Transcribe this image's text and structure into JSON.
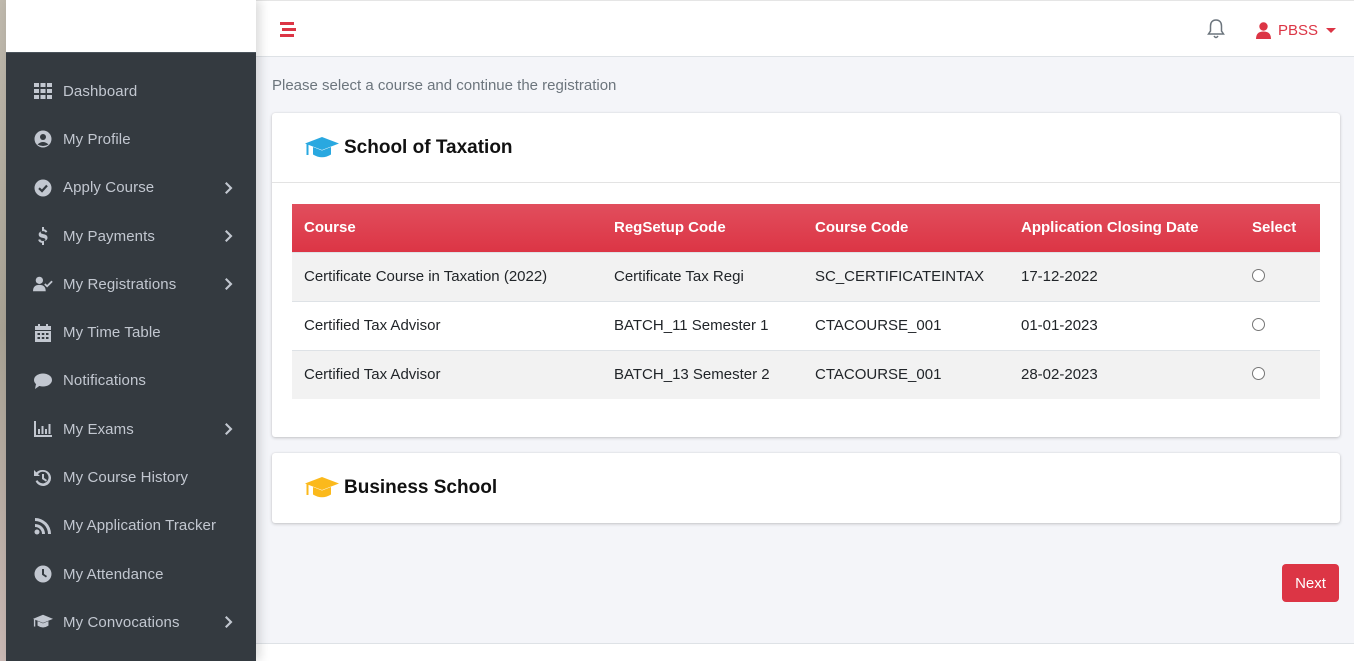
{
  "sidebar": {
    "items": [
      {
        "label": "Dashboard",
        "icon": "grid-icon",
        "has_submenu": false
      },
      {
        "label": "My Profile",
        "icon": "user-circle-icon",
        "has_submenu": false
      },
      {
        "label": "Apply Course",
        "icon": "check-circle-icon",
        "has_submenu": true
      },
      {
        "label": "My Payments",
        "icon": "dollar-icon",
        "has_submenu": true
      },
      {
        "label": "My Registrations",
        "icon": "user-check-icon",
        "has_submenu": true
      },
      {
        "label": "My Time Table",
        "icon": "calendar-icon",
        "has_submenu": false
      },
      {
        "label": "Notifications",
        "icon": "comment-icon",
        "has_submenu": false
      },
      {
        "label": "My Exams",
        "icon": "chart-bar-icon",
        "has_submenu": true
      },
      {
        "label": "My Course History",
        "icon": "history-icon",
        "has_submenu": false
      },
      {
        "label": "My Application Tracker",
        "icon": "rss-icon",
        "has_submenu": false
      },
      {
        "label": "My Attendance",
        "icon": "clock-icon",
        "has_submenu": false
      },
      {
        "label": "My Convocations",
        "icon": "graduation-cap-icon",
        "has_submenu": true
      }
    ]
  },
  "topbar": {
    "user_name": "PBSS"
  },
  "main": {
    "intro": "Please select a course and continue the registration",
    "schools": [
      {
        "title": "School of Taxation",
        "icon_color": "#29a8e0",
        "table": {
          "headers": [
            "Course",
            "RegSetup Code",
            "Course Code",
            "Application Closing Date",
            "Select"
          ],
          "rows": [
            {
              "course": "Certificate Course in Taxation (2022)",
              "regsetup": "Certificate Tax Regi",
              "code": "SC_CERTIFICATEINTAX",
              "closing": "17-12-2022",
              "selected": false
            },
            {
              "course": "Certified Tax Advisor",
              "regsetup": "BATCH_11 Semester 1",
              "code": "CTACOURSE_001",
              "closing": "01-01-2023",
              "selected": false
            },
            {
              "course": "Certified Tax Advisor",
              "regsetup": "BATCH_13 Semester 2",
              "code": "CTACOURSE_001",
              "closing": "28-02-2023",
              "selected": false
            }
          ]
        }
      },
      {
        "title": "Business School",
        "icon_color": "#fbb91c"
      }
    ],
    "next_label": "Next"
  },
  "colors": {
    "accent": "#dc3545",
    "sidebar_bg": "#343a40",
    "sidebar_text": "#c2c7d0"
  }
}
